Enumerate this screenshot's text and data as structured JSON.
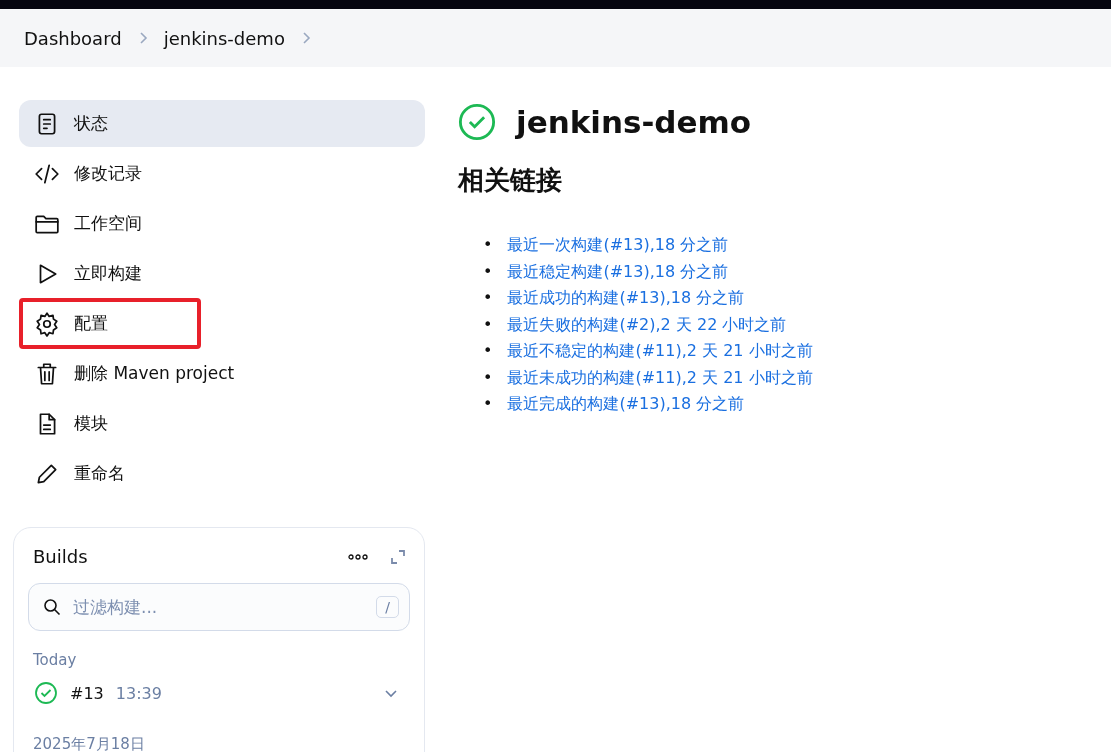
{
  "breadcrumbs": [
    {
      "label": "Dashboard"
    },
    {
      "label": "jenkins-demo"
    }
  ],
  "sidebar": {
    "items": [
      {
        "label": "状态",
        "kind": "document",
        "selected": true,
        "highlighted": false
      },
      {
        "label": "修改记录",
        "kind": "code",
        "selected": false,
        "highlighted": false
      },
      {
        "label": "工作空间",
        "kind": "folder",
        "selected": false,
        "highlighted": false
      },
      {
        "label": "立即构建",
        "kind": "play",
        "selected": false,
        "highlighted": false
      },
      {
        "label": "配置",
        "kind": "gear",
        "selected": false,
        "highlighted": true
      },
      {
        "label": "删除 Maven project",
        "kind": "trash",
        "selected": false,
        "highlighted": false
      },
      {
        "label": "模块",
        "kind": "file",
        "selected": false,
        "highlighted": false
      },
      {
        "label": "重命名",
        "kind": "pencil",
        "selected": false,
        "highlighted": false
      }
    ]
  },
  "builds": {
    "title": "Builds",
    "filter": {
      "placeholder": "过滤构建...",
      "shortcut": "/"
    },
    "groups": [
      {
        "label": "Today",
        "builds": [
          {
            "number": "#13",
            "time": "13:39",
            "kind": "success"
          }
        ]
      },
      {
        "label": "2025年7月18日"
      }
    ]
  },
  "project": {
    "title": "jenkins-demo",
    "kind": "success"
  },
  "related_links": {
    "heading": "相关链接",
    "links": [
      {
        "marker": "•",
        "text": "最近一次构建(#13),18 分之前"
      },
      {
        "marker": "•",
        "text": "最近稳定构建(#13),18 分之前"
      },
      {
        "marker": "•",
        "text": "最近成功的构建(#13),18 分之前"
      },
      {
        "marker": "•",
        "text": "最近失败的构建(#2),2 天 22 小时之前"
      },
      {
        "marker": "•",
        "text": "最近不稳定的构建(#11),2 天 21 小时之前"
      },
      {
        "marker": "•",
        "text": "最近未成功的构建(#11),2 天 21 小时之前"
      },
      {
        "marker": "•",
        "text": "最近完成的构建(#13),18 分之前"
      }
    ]
  }
}
